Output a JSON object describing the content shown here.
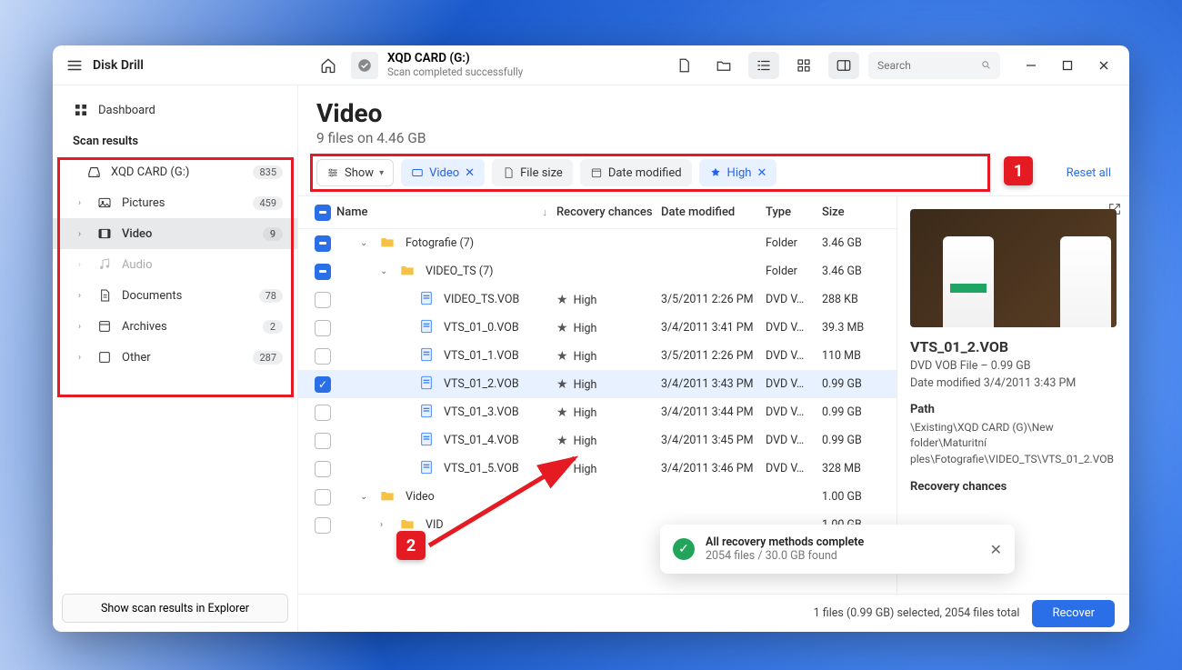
{
  "app_title": "Disk Drill",
  "titlebar": {
    "path_title": "XQD CARD (G:)",
    "path_sub": "Scan completed successfully",
    "search_placeholder": "Search"
  },
  "sidebar": {
    "dashboard": "Dashboard",
    "scan_results": "Scan results",
    "items": [
      {
        "label": "XQD CARD (G:)",
        "count": "835"
      },
      {
        "label": "Pictures",
        "count": "459"
      },
      {
        "label": "Video",
        "count": "9"
      },
      {
        "label": "Audio",
        "count": ""
      },
      {
        "label": "Documents",
        "count": "78"
      },
      {
        "label": "Archives",
        "count": "2"
      },
      {
        "label": "Other",
        "count": "287"
      }
    ],
    "show_in_explorer": "Show scan results in Explorer"
  },
  "header": {
    "title": "Video",
    "subtitle": "9 files on 4.46 GB"
  },
  "filters": {
    "show": "Show",
    "video": "Video",
    "file_size": "File size",
    "date_modified": "Date modified",
    "high": "High",
    "reset": "Reset all"
  },
  "columns": {
    "name": "Name",
    "recovery": "Recovery chances",
    "date": "Date modified",
    "type": "Type",
    "size": "Size"
  },
  "rows": [
    {
      "check": "partial",
      "indent": 0,
      "kind": "folder-exp",
      "name": "Fotografie (7)",
      "rec": "",
      "date": "",
      "type": "Folder",
      "size": "3.46 GB"
    },
    {
      "check": "partial",
      "indent": 1,
      "kind": "folder-exp",
      "name": "VIDEO_TS (7)",
      "rec": "",
      "date": "",
      "type": "Folder",
      "size": "3.46 GB"
    },
    {
      "check": "",
      "indent": 2,
      "kind": "file",
      "name": "VIDEO_TS.VOB",
      "rec": "High",
      "date": "3/5/2011 2:26 PM",
      "type": "DVD V…",
      "size": "288 KB"
    },
    {
      "check": "",
      "indent": 2,
      "kind": "file",
      "name": "VTS_01_0.VOB",
      "rec": "High",
      "date": "3/4/2011 3:41 PM",
      "type": "DVD V…",
      "size": "39.3 MB"
    },
    {
      "check": "",
      "indent": 2,
      "kind": "file",
      "name": "VTS_01_1.VOB",
      "rec": "High",
      "date": "3/5/2011 2:26 PM",
      "type": "DVD V…",
      "size": "110 MB"
    },
    {
      "check": "on",
      "indent": 2,
      "kind": "file",
      "name": "VTS_01_2.VOB",
      "rec": "High",
      "date": "3/4/2011 3:43 PM",
      "type": "DVD V…",
      "size": "0.99 GB",
      "selected": true
    },
    {
      "check": "",
      "indent": 2,
      "kind": "file",
      "name": "VTS_01_3.VOB",
      "rec": "High",
      "date": "3/4/2011 3:44 PM",
      "type": "DVD V…",
      "size": "0.99 GB"
    },
    {
      "check": "",
      "indent": 2,
      "kind": "file",
      "name": "VTS_01_4.VOB",
      "rec": "High",
      "date": "3/4/2011 3:45 PM",
      "type": "DVD V…",
      "size": "0.99 GB"
    },
    {
      "check": "",
      "indent": 2,
      "kind": "file",
      "name": "VTS_01_5.VOB",
      "rec": "High",
      "date": "3/4/2011 3:46 PM",
      "type": "DVD V…",
      "size": "328 MB"
    },
    {
      "check": "",
      "indent": 0,
      "kind": "folder-exp",
      "name": "Video",
      "rec": "",
      "date": "",
      "type": "",
      "size": "1.00 GB"
    },
    {
      "check": "",
      "indent": 1,
      "kind": "folder-col",
      "name": "VID",
      "rec": "",
      "date": "",
      "type": "",
      "size": "1.00 GB"
    }
  ],
  "details": {
    "title": "VTS_01_2.VOB",
    "line1": "DVD VOB File – 0.99 GB",
    "line2": "Date modified 3/4/2011 3:43 PM",
    "path_label": "Path",
    "path": "\\Existing\\XQD CARD (G)\\New folder\\Maturitní ples\\Fotografie\\VIDEO_TS\\VTS_01_2.VOB",
    "chances_label": "Recovery chances"
  },
  "toast": {
    "title": "All recovery methods complete",
    "sub": "2054 files / 30.0 GB found"
  },
  "statusbar": {
    "summary": "1 files (0.99 GB) selected, 2054 files total",
    "recover": "Recover"
  },
  "annotations": {
    "badge1": "1",
    "badge2": "2"
  }
}
